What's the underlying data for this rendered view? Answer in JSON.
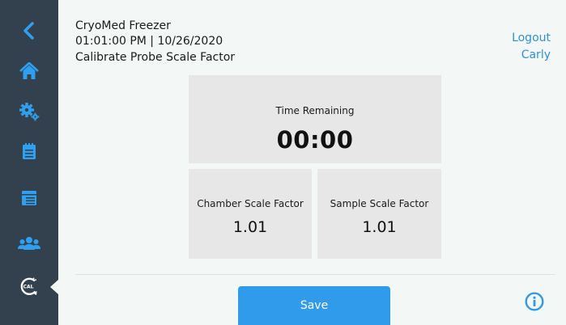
{
  "header": {
    "device_name": "CryoMed Freezer",
    "datetime": "01:01:00 PM | 10/26/2020",
    "page_title": "Calibrate Probe Scale Factor",
    "logout_label": "Logout",
    "username": "Carly"
  },
  "sidebar": {
    "items": [
      {
        "icon": "back-chevron-icon"
      },
      {
        "icon": "home-icon"
      },
      {
        "icon": "settings-gears-icon"
      },
      {
        "icon": "clipboard-icon"
      },
      {
        "icon": "records-icon"
      },
      {
        "icon": "users-icon"
      },
      {
        "icon": "calibration-icon",
        "icon_text": "CAL",
        "active": true
      }
    ]
  },
  "timer": {
    "label": "Time Remaining",
    "value": "00:00"
  },
  "chamber": {
    "label": "Chamber Scale Factor",
    "value": "1.01"
  },
  "sample": {
    "label": "Sample Scale Factor",
    "value": "1.01"
  },
  "actions": {
    "save_label": "Save",
    "info_icon": "info-icon"
  },
  "colors": {
    "sidebar": "#32414d",
    "accent": "#2f9bea",
    "link": "#2f92d6",
    "panel": "#e7e7e7",
    "background": "#f3f7f6"
  }
}
